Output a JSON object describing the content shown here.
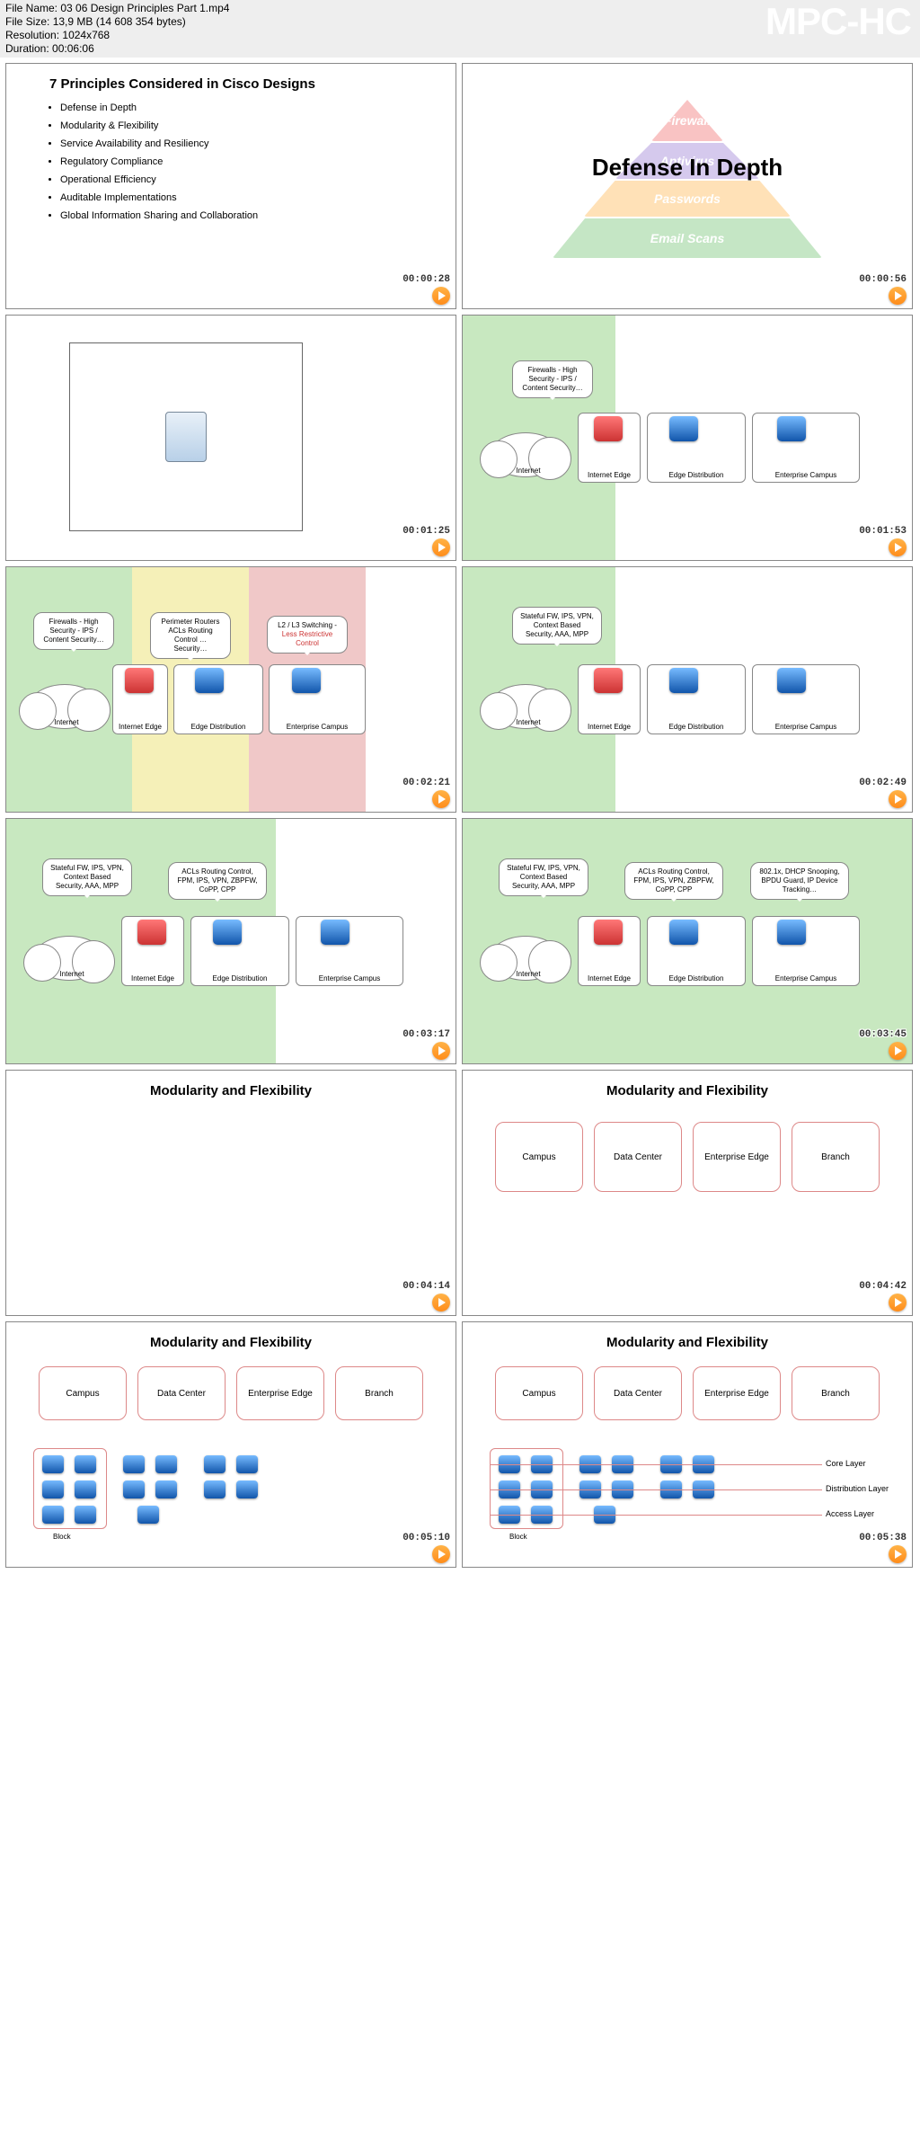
{
  "header": {
    "file_name_label": "File Name:",
    "file_name": "03 06 Design Principles Part 1.mp4",
    "file_size_label": "File Size:",
    "file_size": "13,9 MB (14 608 354 bytes)",
    "resolution_label": "Resolution:",
    "resolution": "1024x768",
    "duration_label": "Duration:",
    "duration": "00:06:06",
    "watermark": "MPC-HC"
  },
  "thumbnails": [
    {
      "ts": "00:00:28"
    },
    {
      "ts": "00:00:56"
    },
    {
      "ts": "00:01:25"
    },
    {
      "ts": "00:01:53"
    },
    {
      "ts": "00:02:21"
    },
    {
      "ts": "00:02:49"
    },
    {
      "ts": "00:03:17"
    },
    {
      "ts": "00:03:45"
    },
    {
      "ts": "00:04:14"
    },
    {
      "ts": "00:04:42"
    },
    {
      "ts": "00:05:10"
    },
    {
      "ts": "00:05:38"
    }
  ],
  "slide1": {
    "title": "7 Principles Considered in Cisco Designs",
    "bullets": [
      "Defense in Depth",
      "Modularity & Flexibility",
      "Service Availability and Resiliency",
      "Regulatory Compliance",
      "Operational Efficiency",
      "Auditable Implementations",
      "Global Information Sharing and Collaboration"
    ]
  },
  "slide2": {
    "title": "Defense In Depth",
    "pyramid": [
      "Firewall",
      "Antivirus",
      "Passwords",
      "Email Scans"
    ]
  },
  "network": {
    "internet": "Internet",
    "edge": "Internet Edge",
    "dist": "Edge Distribution",
    "campus": "Enterprise Campus"
  },
  "bubbles": {
    "fw": "Firewalls - High Security - IPS / Content Security…",
    "perimeter": "Perimeter Routers ACLs Routing Control … Security…",
    "l2l3": "L2 / L3 Switching - ",
    "l2l3_red": "Less Restrictive Control",
    "stateful": "Stateful FW, IPS, VPN, Context Based Security, AAA, MPP",
    "acls": "ACLs Routing Control, FPM, IPS, VPN, ZBPFW, CoPP, CPP",
    "dhcp": "802.1x, DHCP Snooping, BPDU Guard, IP Device Tracking…"
  },
  "modularity": {
    "title": "Modularity and Flexibility",
    "boxes": [
      "Campus",
      "Data Center",
      "Enterprise Edge",
      "Branch"
    ],
    "block": "Block",
    "layers": [
      "Core Layer",
      "Distribution Layer",
      "Access Layer"
    ]
  }
}
